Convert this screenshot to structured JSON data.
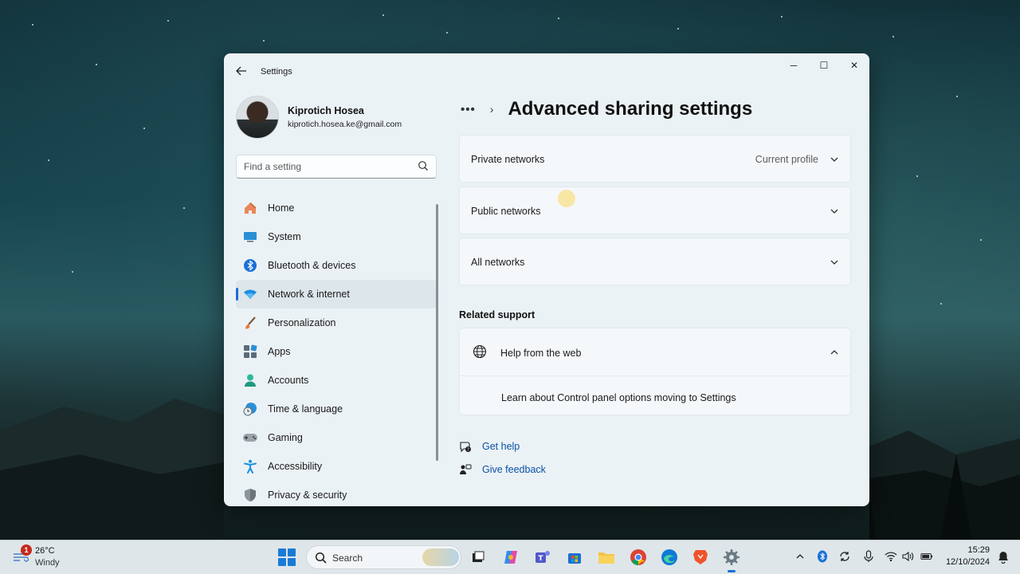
{
  "window": {
    "app_title": "Settings",
    "controls": {
      "minimize": "─",
      "maximize": "☐",
      "close": "✕"
    }
  },
  "profile": {
    "name": "Kiprotich Hosea",
    "email": "kiprotich.hosea.ke@gmail.com"
  },
  "search": {
    "placeholder": "Find a setting"
  },
  "sidebar": {
    "items": [
      {
        "label": "Home",
        "icon": "home-icon"
      },
      {
        "label": "System",
        "icon": "system-icon"
      },
      {
        "label": "Bluetooth & devices",
        "icon": "bluetooth-icon"
      },
      {
        "label": "Network & internet",
        "icon": "wifi-icon",
        "active": true
      },
      {
        "label": "Personalization",
        "icon": "brush-icon"
      },
      {
        "label": "Apps",
        "icon": "apps-icon"
      },
      {
        "label": "Accounts",
        "icon": "accounts-icon"
      },
      {
        "label": "Time & language",
        "icon": "clock-globe-icon"
      },
      {
        "label": "Gaming",
        "icon": "gamepad-icon"
      },
      {
        "label": "Accessibility",
        "icon": "accessibility-icon"
      },
      {
        "label": "Privacy & security",
        "icon": "shield-icon"
      }
    ]
  },
  "breadcrumb": {
    "overflow": "•••",
    "separator": "›"
  },
  "page": {
    "title": "Advanced sharing settings"
  },
  "network_profiles": [
    {
      "label": "Private networks",
      "value": "Current profile"
    },
    {
      "label": "Public networks",
      "value": ""
    },
    {
      "label": "All networks",
      "value": ""
    }
  ],
  "related": {
    "heading": "Related support",
    "help_title": "Help from the web",
    "help_link": "Learn about Control panel options moving to Settings"
  },
  "footer": {
    "get_help": "Get help",
    "give_feedback": "Give feedback"
  },
  "taskbar": {
    "weather": {
      "temp": "26°C",
      "condition": "Windy",
      "badge": "1"
    },
    "search_label": "Search",
    "clock": {
      "time": "15:29",
      "date": "12/10/2024"
    }
  },
  "colors": {
    "accent": "#1a6ed8",
    "link": "#0a4fa8",
    "window_bg": "#ebf2f5"
  }
}
